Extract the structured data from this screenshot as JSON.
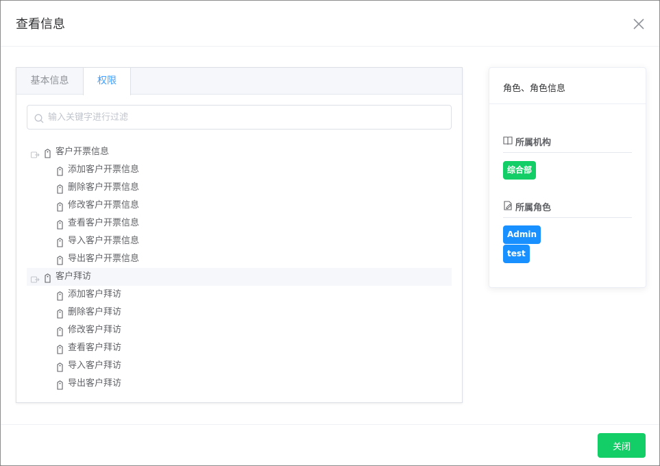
{
  "dialog": {
    "title": "查看信息",
    "close_icon": "close-icon",
    "footer": {
      "close_label": "关闭"
    }
  },
  "tabs": [
    {
      "label": "基本信息",
      "active": false
    },
    {
      "label": "权限",
      "active": true
    }
  ],
  "search": {
    "placeholder": "输入关键字进行过滤",
    "value": ""
  },
  "tree": [
    {
      "label": "客户开票信息",
      "children": [
        "添加客户开票信息",
        "删除客户开票信息",
        "修改客户开票信息",
        "查看客户开票信息",
        "导入客户开票信息",
        "导出客户开票信息"
      ]
    },
    {
      "label": "客户拜访",
      "children": [
        "添加客户拜访",
        "删除客户拜访",
        "修改客户拜访",
        "查看客户拜访",
        "导入客户拜访",
        "导出客户拜访"
      ]
    }
  ],
  "info": {
    "title": "角色、角色信息",
    "org_section": {
      "title": "所属机构",
      "icon": "book-icon",
      "items": [
        "综合部"
      ]
    },
    "role_section": {
      "title": "所属角色",
      "icon": "edit-icon",
      "items": [
        "Admin",
        "test"
      ]
    }
  },
  "colors": {
    "primary": "#409eff",
    "success": "#13ce66",
    "role_badge": "#1890ff"
  }
}
